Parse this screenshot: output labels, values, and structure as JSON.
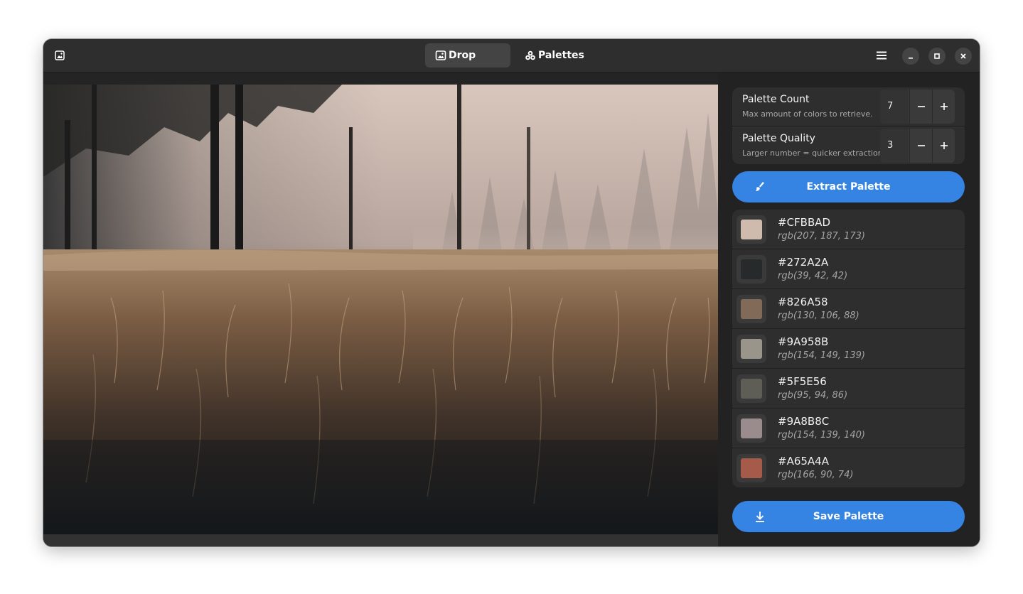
{
  "tabs": [
    {
      "label": "Drop",
      "icon": "image-icon",
      "active": true
    },
    {
      "label": "Palettes",
      "icon": "palette-icon",
      "active": false
    }
  ],
  "settings": {
    "palette_count": {
      "title": "Palette Count",
      "subtitle": "Max amount of colors to retrieve.",
      "value": "7"
    },
    "palette_quality": {
      "title": "Palette Quality",
      "subtitle": "Larger number = quicker extraction.",
      "value": "3"
    }
  },
  "buttons": {
    "extract": "Extract Palette",
    "save": "Save Palette"
  },
  "palette": [
    {
      "hex": "#CFBBAD",
      "rgb": "rgb(207, 187, 173)"
    },
    {
      "hex": "#272A2A",
      "rgb": "rgb(39, 42, 42)"
    },
    {
      "hex": "#826A58",
      "rgb": "rgb(130, 106, 88)"
    },
    {
      "hex": "#9A958B",
      "rgb": "rgb(154, 149, 139)"
    },
    {
      "hex": "#5F5E56",
      "rgb": "rgb(95, 94, 86)"
    },
    {
      "hex": "#9A8B8C",
      "rgb": "rgb(154, 139, 140)"
    },
    {
      "hex": "#A65A4A",
      "rgb": "rgb(166, 90, 74)"
    }
  ],
  "colors": {
    "accent": "#3584e4",
    "window_bg": "#1f1f1f",
    "header_bg": "#2e2e2e"
  }
}
